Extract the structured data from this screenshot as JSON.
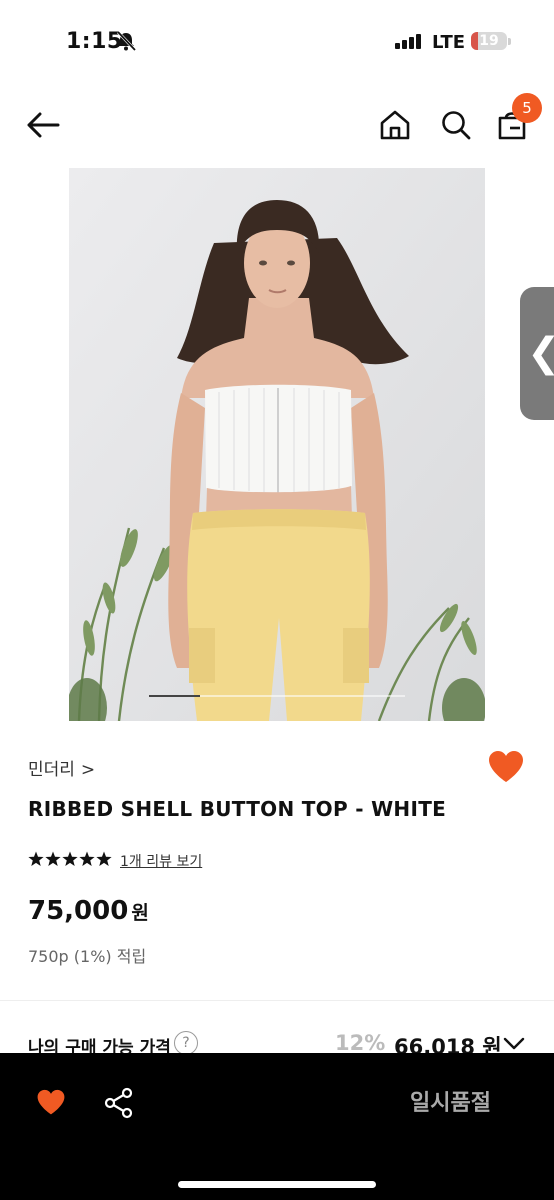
{
  "status": {
    "time": "1:15",
    "network": "LTE",
    "battery": "19",
    "battery_level": 0.19
  },
  "nav": {
    "cart_count": "5",
    "icons": [
      "back-arrow-icon",
      "home-icon",
      "search-icon",
      "cart-icon"
    ]
  },
  "product": {
    "brand": "민더리",
    "brand_arrow": ">",
    "title": "RIBBED SHELL BUTTON TOP - WHITE",
    "rating": 5,
    "review_link": "1개 리뷰 보기",
    "price": "75,000",
    "price_unit": "원",
    "points": "750p (1%) 적립",
    "my_price_label": "나의 구매 가능 가격",
    "help": "?",
    "discount": "12%",
    "my_price": "66,018 원",
    "image_position": 0.2
  },
  "side_tab": "❮",
  "bottom": {
    "status_label": "일시품절"
  },
  "colors": {
    "accent": "#f05a23",
    "bottom_bar": "#000000"
  }
}
